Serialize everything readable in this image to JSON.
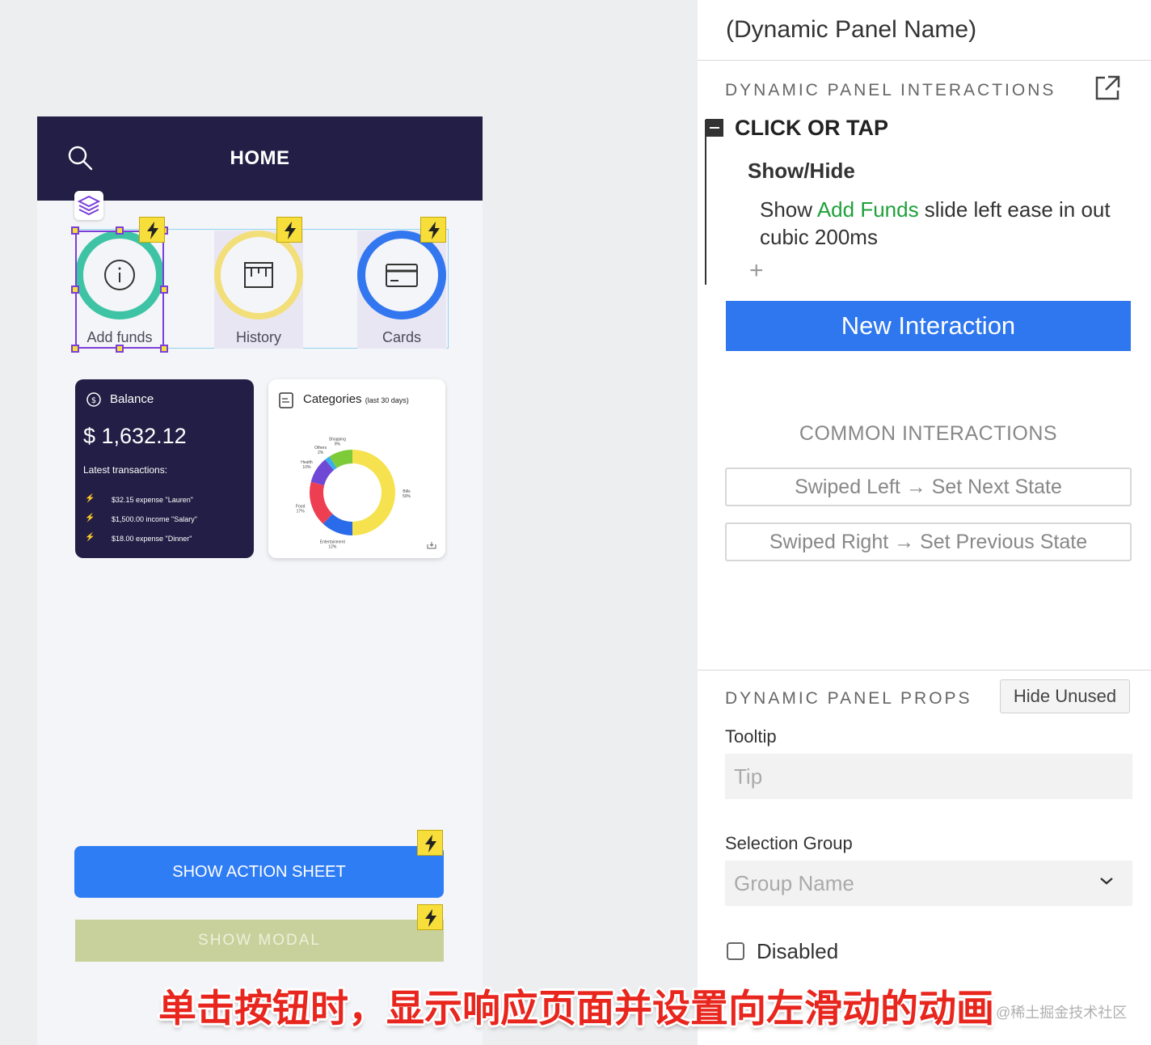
{
  "phone": {
    "header_title": "HOME",
    "shortcuts": [
      {
        "label": "Add funds",
        "ring_color": "#3ec4a4",
        "icon": "info-circle-icon"
      },
      {
        "label": "History",
        "ring_color": "#f2df7a",
        "icon": "receipt-icon"
      },
      {
        "label": "Cards",
        "ring_color": "#3277f0",
        "icon": "credit-card-icon"
      }
    ],
    "balance": {
      "title": "Balance",
      "amount": "$ 1,632.12",
      "latest_label": "Latest transactions:",
      "transactions": [
        "$32.15 expense \"Lauren\"",
        "$1,500.00 income \"Salary\"",
        "$18.00 expense \"Dinner\""
      ]
    },
    "categories": {
      "title": "Categories",
      "subtitle": "(last 30 days)"
    },
    "buttons": {
      "action_sheet": "SHOW ACTION SHEET",
      "modal": "SHOW MODAL"
    }
  },
  "chart_data": {
    "type": "pie",
    "categories": [
      "Bills",
      "Entertainment",
      "Food",
      "Health",
      "Others",
      "Shopping"
    ],
    "values": [
      50,
      12,
      17,
      10,
      2,
      9
    ],
    "labels": [
      {
        "name": "Bills",
        "pct": "50%"
      },
      {
        "name": "Entertainment",
        "pct": "12%"
      },
      {
        "name": "Food",
        "pct": "17%"
      },
      {
        "name": "Health",
        "pct": "10%"
      },
      {
        "name": "Others",
        "pct": "2%"
      },
      {
        "name": "Shopping",
        "pct": "9%"
      }
    ],
    "colors": [
      "#f6e24e",
      "#2a6bea",
      "#ee3f52",
      "#6f49d6",
      "#3ab0e8",
      "#7ecb3a"
    ],
    "title": "Categories (last 30 days)"
  },
  "panel": {
    "title": "(Dynamic Panel Name)",
    "interactions_label": "DYNAMIC PANEL INTERACTIONS",
    "event": "CLICK OR TAP",
    "action": "Show/Hide",
    "desc_prefix": "Show ",
    "desc_target": "Add Funds",
    "desc_suffix": " slide left ease in out cubic 200ms",
    "new_interaction": "New Interaction",
    "common_label": "COMMON INTERACTIONS",
    "common": [
      "Swiped Left → Set Next State",
      "Swiped Right → Set Previous State"
    ],
    "props_label": "DYNAMIC PANEL PROPS",
    "hide_unused": "Hide Unused",
    "tooltip_label": "Tooltip",
    "tooltip_placeholder": "Tip",
    "selection_group_label": "Selection Group",
    "selection_group_placeholder": "Group Name",
    "disabled_label": "Disabled"
  },
  "caption": "单击按钮时，显示响应页面并设置向左滑动的动画",
  "watermark": "@稀土掘金技术社区",
  "colors": {
    "header": "#221e45",
    "primary": "#2e77ee",
    "selection": "#7a3fd8",
    "badge": "#f7de3a",
    "target_green": "#1ea13a"
  }
}
